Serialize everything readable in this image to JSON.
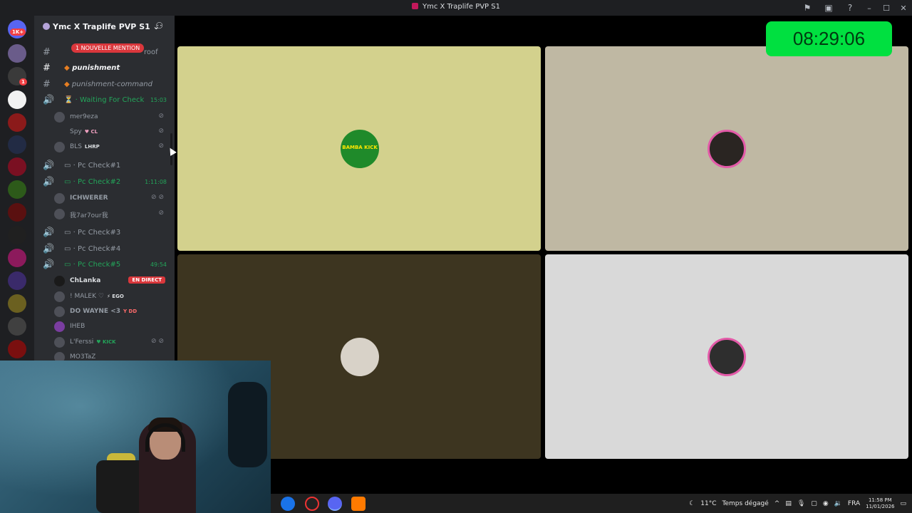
{
  "window": {
    "title": "Ymc X Traplife PVP S1"
  },
  "rail": {
    "top_badge": "1K+",
    "dm_badge": "1"
  },
  "server": {
    "name": "Ymc X Traplife PVP S1",
    "mention_banner": "1 NOUVELLE MENTION",
    "hidden_channel_suffix": "roof"
  },
  "channels": {
    "punishment": "punishment",
    "punishment_command": "punishment-command",
    "waiting": {
      "label": "Waiting For Check",
      "time": "15:03"
    },
    "pc1": "Pc Check#1",
    "pc2": {
      "label": "Pc Check#2",
      "time": "1:11:08"
    },
    "pc3": "Pc Check#3",
    "pc4": "Pc Check#4",
    "pc5": {
      "label": "Pc Check#5",
      "time": "49:54"
    }
  },
  "users": {
    "waiting": [
      {
        "name": "mer9eza",
        "tag": ""
      },
      {
        "name": "Spy",
        "tag": "♥ CL"
      },
      {
        "name": "BLS",
        "tag": "LHRP"
      }
    ],
    "pc2": [
      {
        "name": "ICHWERER",
        "tag": ""
      },
      {
        "name": "我7ar7our我",
        "tag": ""
      }
    ],
    "pc5": [
      {
        "name": "ChLanka",
        "tag": ""
      },
      {
        "name": "! MALEK ♡",
        "tag": "⚡ EGO"
      },
      {
        "name": "DO WAYNE <3",
        "tag": "Y DD"
      },
      {
        "name": "IHEB",
        "tag": ""
      },
      {
        "name": "L'Ferssi",
        "tag": "♥ KICK"
      },
      {
        "name": "MO3TaZ",
        "tag": ""
      }
    ]
  },
  "live_badge": "EN DIRECT",
  "clock": "08:29:06",
  "tiles": [
    {
      "color": "#d3d18d",
      "avatar_text": "BAMBA KICK"
    },
    {
      "color": "#bfb8a3"
    },
    {
      "color": "#3d3520"
    },
    {
      "color": "#d9d9d9"
    }
  ],
  "taskbar": {
    "weather_temp": "11°C",
    "weather_text": "Temps dégagé",
    "lang": "FRA",
    "time": "11:58 PM",
    "date": "11/01/2026"
  }
}
